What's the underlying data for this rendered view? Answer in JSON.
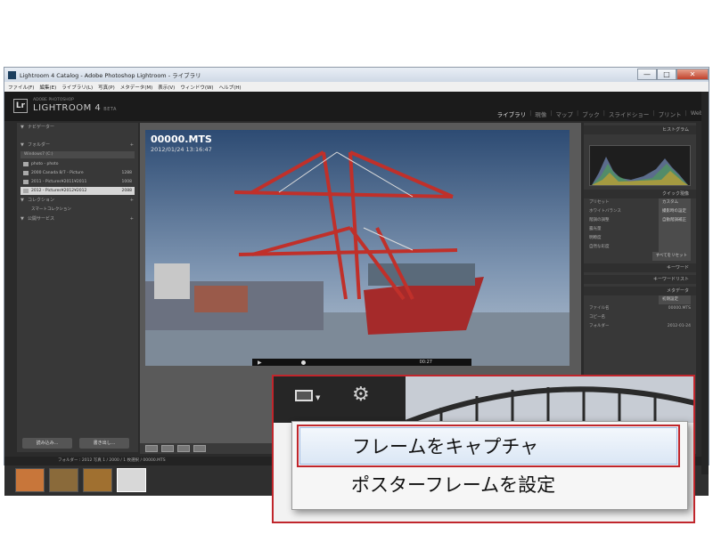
{
  "window": {
    "title": "Lightroom 4 Catalog - Adobe Photoshop Lightroom - ライブラリ",
    "btn_min": "—",
    "btn_max": "□",
    "btn_close": "✕"
  },
  "menubar": [
    "ファイル(F)",
    "編集(E)",
    "ライブラリ(L)",
    "写真(P)",
    "メタデータ(M)",
    "表示(V)",
    "ウィンドウ(W)",
    "ヘルプ(H)"
  ],
  "lr": {
    "logo": "Lr",
    "sub": "ADOBE PHOTOSHOP",
    "name": "LIGHTROOM 4",
    "beta": "BETA",
    "modules": [
      "ライブラリ",
      "現像",
      "マップ",
      "ブック",
      "スライドショー",
      "プリント",
      "Web"
    ]
  },
  "left": {
    "navigator": "ナビゲーター",
    "folders": "フォルダー",
    "volume": "Windows7 (C:)",
    "folder_rows": [
      {
        "name": "photo - photo",
        "count": ""
      },
      {
        "name": "2000 Canada 8/7 - Picture",
        "count": "1288"
      },
      {
        "name": "2011 - Pictures¥2011¥2011",
        "count": "1008"
      },
      {
        "name": "2012 - Pictures¥2012¥2012",
        "count": "2088"
      }
    ],
    "collections": "コレクション",
    "smart": "スマートコレクション",
    "publish": "公開サービス",
    "import_btn": "読み込み...",
    "export_btn": "書き出し..."
  },
  "photo": {
    "filename": "00000.MTS",
    "datetime": "2012/01/24 13:16:47",
    "play": "▶",
    "time": "00:27"
  },
  "right": {
    "histogram": "ヒストグラム",
    "quick": "クイック現像",
    "rows": [
      {
        "label": "プリセット",
        "value": "カスタム"
      },
      {
        "label": "ホワイトバランス",
        "value": "撮影時の設定"
      },
      {
        "label": "階調の調整",
        "value": "自動階調補正"
      },
      {
        "label": "露光量",
        "value": ""
      },
      {
        "label": "明瞭度",
        "value": ""
      },
      {
        "label": "自然な彩度",
        "value": ""
      }
    ],
    "reset": "すべてをリセット",
    "keywords": "キーワード",
    "keyword_list": "キーワードリスト",
    "metadata": "メタデータ",
    "meta_preset": "初期設定",
    "meta_rows": [
      {
        "label": "ファイル名",
        "value": "00000.MTS"
      },
      {
        "label": "コピー名",
        "value": ""
      },
      {
        "label": "フォルダー",
        "value": "2012-01-24"
      }
    ]
  },
  "filmbar": {
    "path": "フォルダー : 2012   写真 1 / 2000   / 1 枚選択 / 00000.MTS"
  },
  "popup": {
    "items": [
      "フレームをキャプチャ",
      "ポスターフレームを設定"
    ],
    "colors": {
      "highlight_border": "#c0262c",
      "accent": "#9fbbe3"
    }
  }
}
